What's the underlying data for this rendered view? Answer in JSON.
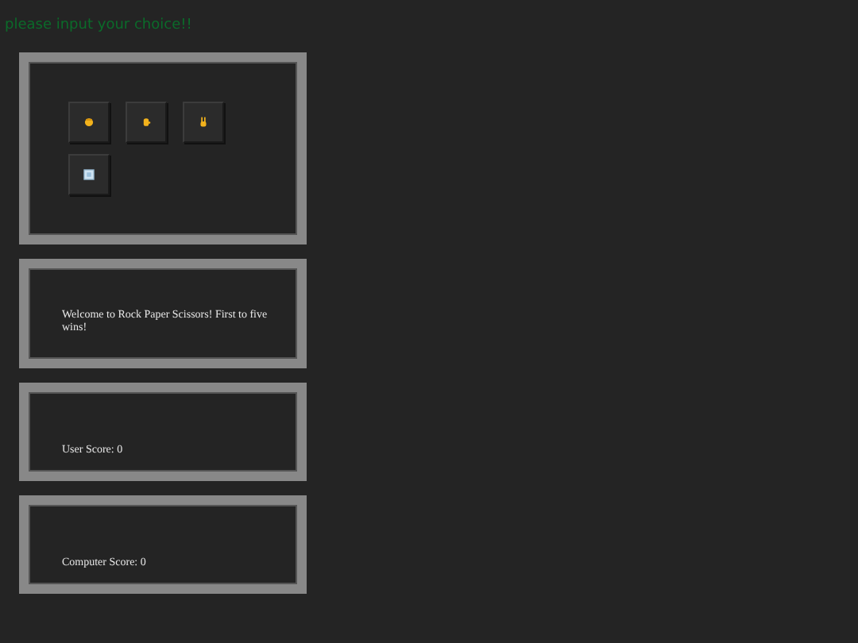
{
  "heading": "please input your choice!!",
  "choices": [
    {
      "kind": "rock"
    },
    {
      "kind": "paper"
    },
    {
      "kind": "scissors"
    },
    {
      "kind": "reset"
    }
  ],
  "message": "Welcome to Rock Paper Scissors! First to five wins!",
  "user_score": "User Score: 0",
  "computer_score": "Computer Score: 0"
}
